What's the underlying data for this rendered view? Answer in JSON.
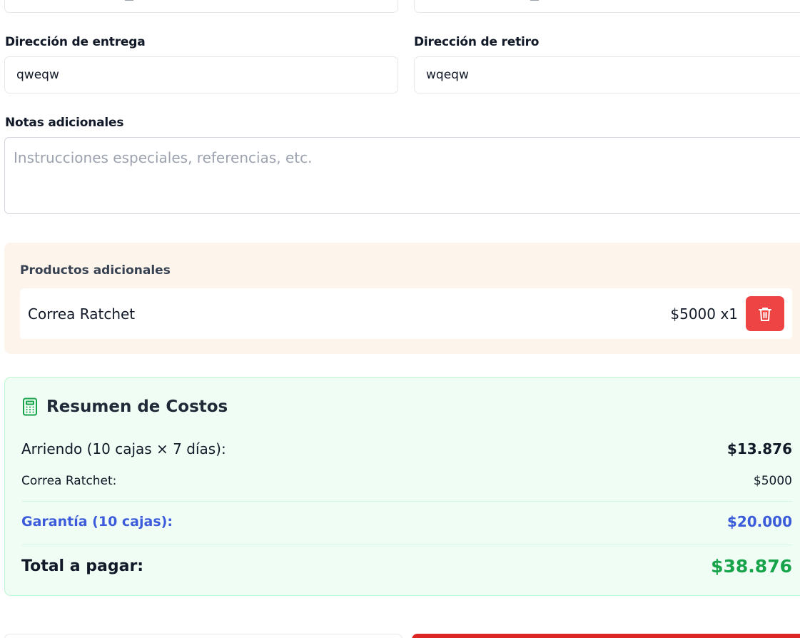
{
  "form": {
    "delivery_label": "Dirección de entrega",
    "delivery_value": "qweqw",
    "pickup_label": "Dirección de retiro",
    "pickup_value": "wqeqw",
    "notes_label": "Notas adicionales",
    "notes_placeholder": "Instrucciones especiales, referencias, etc."
  },
  "extras": {
    "title": "Productos adicionales",
    "items": [
      {
        "name": "Correa Ratchet",
        "price": "$5000",
        "qty": "x1",
        "icon": "trash-icon"
      }
    ]
  },
  "summary": {
    "icon": "calculator-icon",
    "title": "Resumen de Costos",
    "rental_label": "Arriendo (10 cajas × 7 días):",
    "rental_value": "$13.876",
    "extra_label": "Correa Ratchet:",
    "extra_value": "$5000",
    "deposit_label": "Garantía (10 cajas):",
    "deposit_value": "$20.000",
    "total_label": "Total a pagar:",
    "total_value": "$38.876"
  },
  "colors": {
    "accent_blue": "#3b5bdb",
    "total_green": "#16a34a",
    "delete_red": "#ef4444",
    "icon_green": "#16a34a"
  }
}
